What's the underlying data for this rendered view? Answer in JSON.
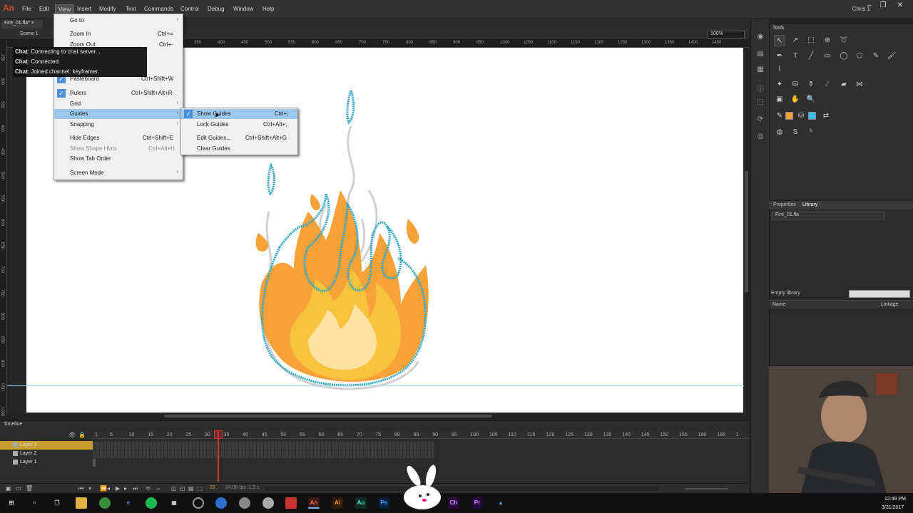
{
  "app": {
    "logo": "An"
  },
  "menubar": {
    "items": [
      "File",
      "Edit",
      "View",
      "Insert",
      "Modify",
      "Text",
      "Commands",
      "Control",
      "Debug",
      "Window",
      "Help"
    ],
    "user": "Chris 1"
  },
  "document": {
    "tab": "Fire_01.fla*",
    "scene": "Scene 1",
    "zoom": "100%"
  },
  "ruler": {
    "top": [
      "350",
      "400",
      "450",
      "500",
      "550",
      "600",
      "650",
      "700",
      "750",
      "800",
      "850",
      "900",
      "950",
      "1000",
      "1050",
      "1100",
      "1150",
      "1200",
      "1250",
      "1300",
      "1350",
      "1400",
      "1450"
    ],
    "left": [
      "250",
      "300",
      "350",
      "400",
      "450",
      "500",
      "550",
      "600",
      "650",
      "700",
      "750",
      "800",
      "850",
      "900",
      "950",
      "1000",
      "1050"
    ]
  },
  "view_menu": {
    "items": [
      {
        "label": "Go to",
        "shortcut": "",
        "submenu": true
      },
      {
        "label": "Zoom In",
        "shortcut": "Ctrl+="
      },
      {
        "label": "Zoom Out",
        "shortcut": "Ctrl+-"
      },
      {
        "label": "Pasteboard",
        "shortcut": "Ctrl+Shift+W",
        "checked": true
      },
      {
        "label": "Rulers",
        "shortcut": "Ctrl+Shift+Alt+R",
        "checked": true
      },
      {
        "label": "Grid",
        "shortcut": "",
        "submenu": true
      },
      {
        "label": "Guides",
        "shortcut": "",
        "submenu": true,
        "highlighted": true
      },
      {
        "label": "Snapping",
        "shortcut": "",
        "submenu": true
      },
      {
        "label": "Hide Edges",
        "shortcut": "Ctrl+Shift+E"
      },
      {
        "label": "Show Shape Hints",
        "shortcut": "Ctrl+Alt+H",
        "disabled": true
      },
      {
        "label": "Show Tab Order",
        "shortcut": ""
      },
      {
        "label": "Screen Mode",
        "shortcut": "",
        "submenu": true
      }
    ]
  },
  "guides_menu": {
    "items": [
      {
        "label": "Show Guides",
        "shortcut": "Ctrl+;",
        "checked": true,
        "highlighted": true
      },
      {
        "label": "Lock Guides",
        "shortcut": "Ctrl+Alt+;"
      },
      {
        "label": "Edit Guides...",
        "shortcut": "Ctrl+Shift+Alt+G"
      },
      {
        "label": "Clear Guides",
        "shortcut": ""
      }
    ]
  },
  "chat": [
    {
      "who": "Chat",
      "msg": ": Connecting to chat server..."
    },
    {
      "who": "Chat",
      "msg": ": Connected."
    },
    {
      "who": "Chat",
      "msg": ": Joined channel: keyframer."
    }
  ],
  "tools_panel": {
    "title": "Tools"
  },
  "library_panel": {
    "tabs": [
      "Properties",
      "Library"
    ],
    "file": "Fire_01.fla",
    "empty_text": "Empty library",
    "col_name": "Name",
    "col_linkage": "Linkage"
  },
  "timeline": {
    "title": "Timeline",
    "frame_numbers": [
      "1",
      "5",
      "10",
      "15",
      "20",
      "25",
      "30",
      "35",
      "40",
      "45",
      "50",
      "55",
      "60",
      "65",
      "70",
      "75",
      "80",
      "85",
      "90",
      "95",
      "100",
      "105",
      "110",
      "115",
      "120",
      "125",
      "130",
      "135",
      "140",
      "145",
      "150",
      "155",
      "160",
      "165",
      "1"
    ],
    "layers": [
      "Layer 3",
      "Layer 2",
      "Layer 1"
    ],
    "current_frame": "33",
    "fps": "24.00 fps",
    "seconds": "1.3 s"
  },
  "colors": {
    "accent": "#4b8fd6",
    "fire_outer": "#f7a139",
    "fire_mid": "#f9c23c",
    "fire_inner": "#fde2a1",
    "guide": "#2fa8cc"
  },
  "taskbar": {
    "time": "12:49 PM",
    "date": "3/31/2017",
    "icons": [
      "windows-icon",
      "search-icon",
      "task-view-icon",
      "explorer-icon",
      "chrome-icon",
      "edge-icon",
      "spotify-icon",
      "store-icon",
      "obs-icon",
      "app-icon",
      "app2-icon",
      "app3-icon",
      "app4-icon",
      "animate-icon",
      "illustrator-icon",
      "audition-icon",
      "photoshop-icon",
      "bunny-icon",
      "character-animator-icon",
      "premiere-icon",
      "adobe-cc-icon"
    ]
  }
}
